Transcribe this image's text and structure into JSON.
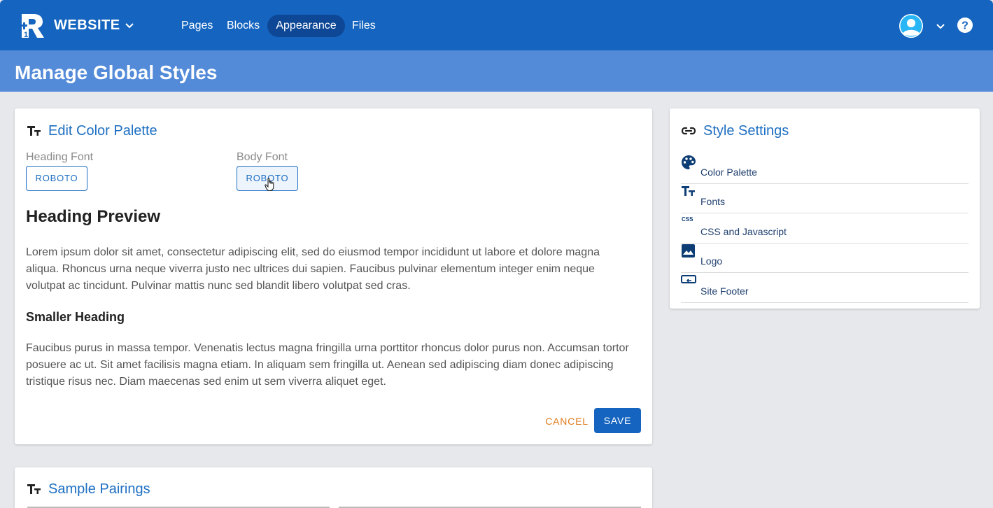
{
  "brand": {
    "site_name": "WEBSITE"
  },
  "nav": {
    "items": [
      {
        "label": "Pages"
      },
      {
        "label": "Blocks"
      },
      {
        "label": "Appearance",
        "active": true
      },
      {
        "label": "Files"
      }
    ]
  },
  "page": {
    "title": "Manage Global Styles"
  },
  "editor": {
    "title": "Edit Color Palette",
    "heading_font_label": "Heading Font",
    "heading_font_value": "ROBOTO",
    "body_font_label": "Body Font",
    "body_font_value": "ROBOTO",
    "heading_preview": "Heading Preview",
    "paragraph_1": "Lorem ipsum dolor sit amet, consectetur adipiscing elit, sed do eiusmod tempor incididunt ut labore et dolore magna aliqua. Rhoncus urna neque viverra justo nec ultrices dui sapien. Faucibus pulvinar elementum integer enim neque volutpat ac tincidunt. Pulvinar mattis nunc sed blandit libero volutpat sed cras.",
    "smaller_heading": "Smaller Heading",
    "paragraph_2": "Faucibus purus in massa tempor. Venenatis lectus magna fringilla urna porttitor rhoncus dolor purus non. Accumsan tortor posuere ac ut. Sit amet facilisis magna etiam. In aliquam sem fringilla ut. Aenean sed adipiscing diam donec adipiscing tristique risus nec. Diam maecenas sed enim ut sem viverra aliquet eget.",
    "cancel_label": "CANCEL",
    "save_label": "SAVE"
  },
  "pairings": {
    "title": "Sample Pairings"
  },
  "style_settings": {
    "title": "Style Settings",
    "items": [
      {
        "label": "Color Palette",
        "icon": "palette-icon"
      },
      {
        "label": "Fonts",
        "icon": "text-fields-icon"
      },
      {
        "label": "CSS and Javascript",
        "icon": "css-icon"
      },
      {
        "label": "Logo",
        "icon": "image-icon"
      },
      {
        "label": "Site Footer",
        "icon": "footer-icon"
      }
    ]
  },
  "colors": {
    "primary": "#1565c0",
    "title_bar": "#548bd8",
    "link": "#1e6fc2",
    "cancel": "#e07b1c",
    "avatar": "#29b6f6"
  }
}
